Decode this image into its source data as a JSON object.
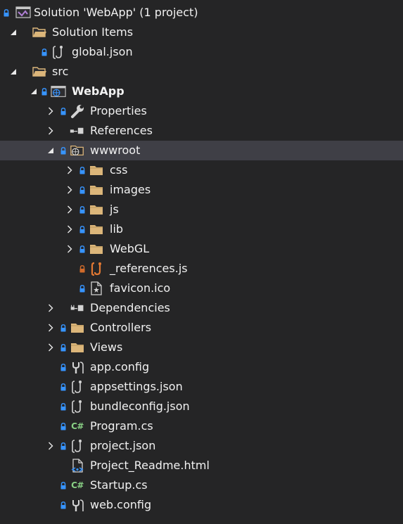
{
  "tree": {
    "rows": [
      {
        "label": "Solution 'WebApp' (1 project)",
        "icon": "solution-icon",
        "lock": true,
        "expander": "none"
      },
      {
        "label": "Solution Items",
        "icon": "folder-open-icon",
        "lock": false,
        "expander": "expanded"
      },
      {
        "label": "global.json",
        "icon": "json-file-icon",
        "lock": true,
        "expander": "none"
      },
      {
        "label": "src",
        "icon": "folder-open-icon",
        "lock": false,
        "expander": "expanded"
      },
      {
        "label": "WebApp",
        "icon": "web-project-icon",
        "lock": true,
        "expander": "expanded",
        "bold": true
      },
      {
        "label": "Properties",
        "icon": "wrench-icon",
        "lock": true,
        "expander": "collapsed"
      },
      {
        "label": "References",
        "icon": "references-icon",
        "lock": false,
        "expander": "collapsed"
      },
      {
        "label": "wwwroot",
        "icon": "web-folder-icon",
        "lock": true,
        "expander": "expanded",
        "selected": true
      },
      {
        "label": "css",
        "icon": "folder-icon",
        "lock": true,
        "expander": "collapsed"
      },
      {
        "label": "images",
        "icon": "folder-icon",
        "lock": true,
        "expander": "collapsed"
      },
      {
        "label": "js",
        "icon": "folder-icon",
        "lock": true,
        "expander": "collapsed"
      },
      {
        "label": "lib",
        "icon": "folder-icon",
        "lock": true,
        "expander": "collapsed"
      },
      {
        "label": "WebGL",
        "icon": "folder-icon",
        "lock": true,
        "expander": "collapsed"
      },
      {
        "label": "_references.js",
        "icon": "js-file-icon",
        "lock": true,
        "lock_color": "#d16b2b",
        "expander": "none"
      },
      {
        "label": "favicon.ico",
        "icon": "favicon-file-icon",
        "lock": true,
        "expander": "none"
      },
      {
        "label": "Dependencies",
        "icon": "dependencies-icon",
        "lock": false,
        "expander": "collapsed"
      },
      {
        "label": "Controllers",
        "icon": "folder-icon",
        "lock": true,
        "expander": "collapsed"
      },
      {
        "label": "Views",
        "icon": "folder-icon",
        "lock": true,
        "expander": "collapsed"
      },
      {
        "label": "app.config",
        "icon": "config-file-icon",
        "lock": true,
        "expander": "none"
      },
      {
        "label": "appsettings.json",
        "icon": "json-file-icon",
        "lock": true,
        "expander": "none"
      },
      {
        "label": "bundleconfig.json",
        "icon": "json-file-icon",
        "lock": true,
        "expander": "none"
      },
      {
        "label": "Program.cs",
        "icon": "csharp-file-icon",
        "lock": true,
        "expander": "none"
      },
      {
        "label": "project.json",
        "icon": "json-file-icon",
        "lock": true,
        "expander": "collapsed"
      },
      {
        "label": "Project_Readme.html",
        "icon": "html-file-icon",
        "lock": false,
        "expander": "none"
      },
      {
        "label": "Startup.cs",
        "icon": "csharp-file-icon",
        "lock": true,
        "expander": "none"
      },
      {
        "label": "web.config",
        "icon": "config-file-icon",
        "lock": true,
        "expander": "none"
      }
    ]
  },
  "colors": {
    "background": "#252526",
    "selected_row": "#3f3f46",
    "text": "#f1f1f1",
    "folder": "#dcb67a",
    "lock": "#3794ff",
    "csharp": "#89d185",
    "js_icon": "#e37933"
  }
}
